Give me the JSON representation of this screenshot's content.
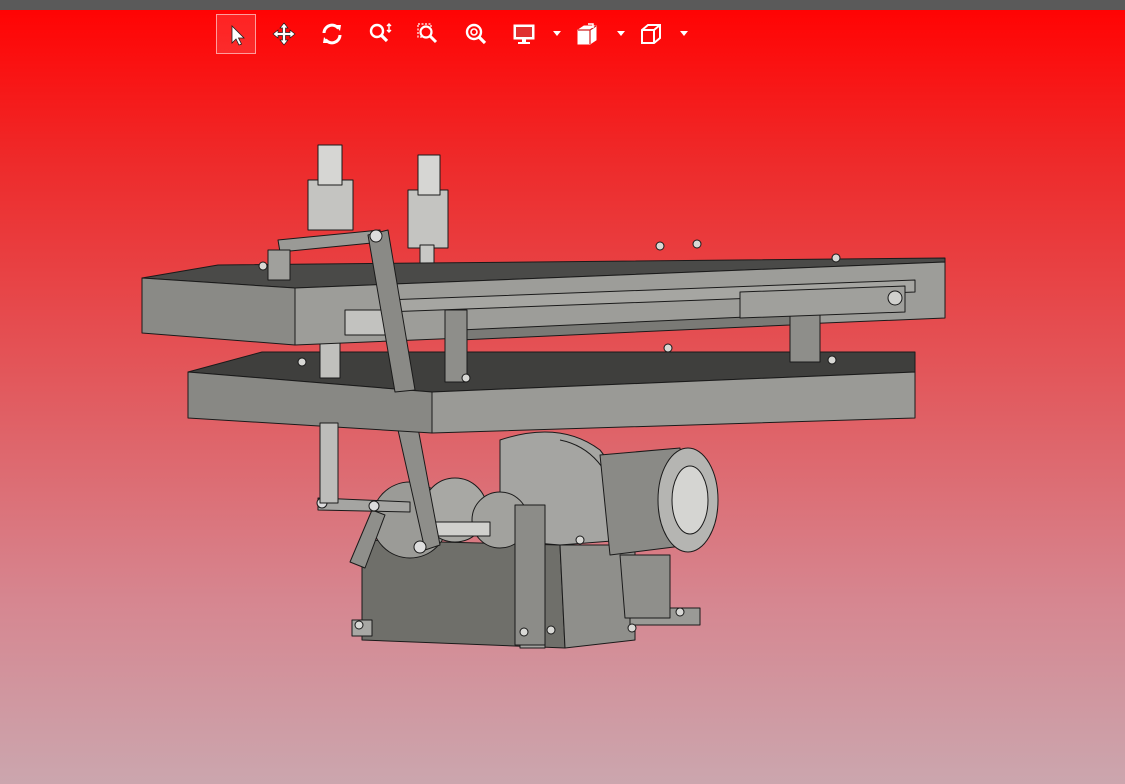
{
  "viewer": {
    "background_top": "#ff0000",
    "background_bottom": "#cba6ae",
    "top_strip_color": "#5a5a5a"
  },
  "toolbar": {
    "items": [
      {
        "icon": "select-arrow-icon",
        "state": "active"
      },
      {
        "icon": "pan-move-icon"
      },
      {
        "icon": "rotate-icon"
      },
      {
        "icon": "zoom-icon"
      },
      {
        "icon": "zoom-window-icon"
      },
      {
        "icon": "zoom-fit-icon"
      },
      {
        "icon": "display-mode-icon",
        "has_dropdown": true
      },
      {
        "icon": "section-view-icon",
        "has_dropdown": true
      },
      {
        "icon": "view-cube-icon",
        "has_dropdown": true
      }
    ]
  },
  "model": {
    "title": "",
    "description": "",
    "colors": {
      "base": "#8f8f8b",
      "top": "#3f3f3d",
      "dark": "#6f6f6a",
      "edge": "#1a1a1a",
      "metal": "#cfcfcb"
    }
  }
}
